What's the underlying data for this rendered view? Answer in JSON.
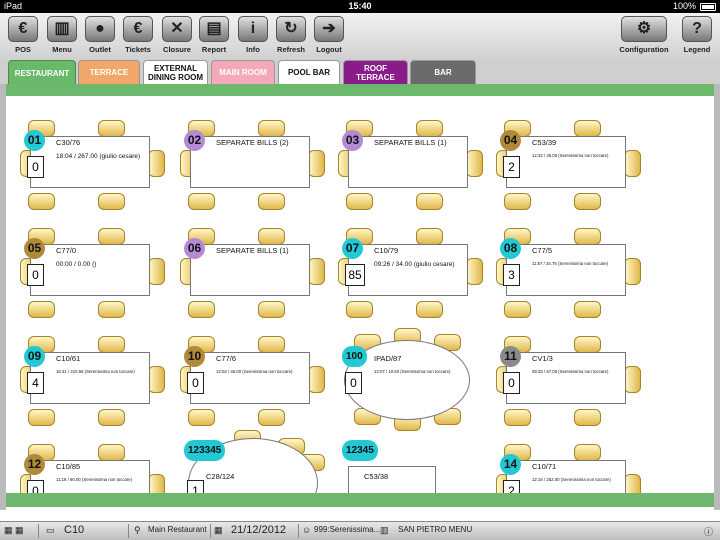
{
  "status_bar": {
    "device": "iPad",
    "time": "15:40",
    "battery": "100%"
  },
  "toolbar": {
    "left": [
      {
        "label": "POS",
        "icon": "cash-register-icon",
        "glyph": "€"
      },
      {
        "label": "Menu",
        "icon": "book-icon",
        "glyph": "▥"
      },
      {
        "label": "Outlet",
        "icon": "map-pin-icon",
        "glyph": "●"
      },
      {
        "label": "Tickets",
        "icon": "ticket-icon",
        "glyph": "€"
      },
      {
        "label": "Closure",
        "icon": "closure-icon",
        "glyph": "✕"
      },
      {
        "label": "Report",
        "icon": "report-icon",
        "glyph": "▤"
      },
      {
        "label": "Info",
        "icon": "info-icon",
        "glyph": "i"
      },
      {
        "label": "Refresh",
        "icon": "refresh-icon",
        "glyph": "↻"
      },
      {
        "label": "Logout",
        "icon": "logout-icon",
        "glyph": "➔"
      }
    ],
    "right": [
      {
        "label": "Configuration",
        "icon": "gears-icon",
        "glyph": "⚙"
      },
      {
        "label": "Legend",
        "icon": "legend-icon",
        "glyph": "?"
      }
    ]
  },
  "tabs": [
    {
      "label": "RESTAURANT",
      "bg": "#6ab86a",
      "fg": "#ffffff",
      "active": true
    },
    {
      "label": "TERRACE",
      "bg": "#f2a76a",
      "fg": "#ffffff",
      "active": false
    },
    {
      "label": "EXTERNAL",
      "label2": "DINING ROOM",
      "bg": "#ffffff",
      "fg": "#111111",
      "active": false
    },
    {
      "label": "MAIN ROOM",
      "bg": "#f4a8b8",
      "fg": "#ffffff",
      "active": false
    },
    {
      "label": "POOL BAR",
      "bg": "#ffffff",
      "fg": "#111111",
      "active": false
    },
    {
      "label": "ROOF TERRACE",
      "bg": "#8a1b8a",
      "fg": "#ffffff",
      "active": false
    },
    {
      "label": "BAR",
      "bg": "#6a6a6a",
      "fg": "#ffffff",
      "active": false
    }
  ],
  "badge_colors": {
    "cyan": "#22c8d4",
    "purple": "#b48ad4",
    "gold": "#b08a3a",
    "gray": "#8a8a8a"
  },
  "tables": [
    {
      "number": "01",
      "badge": "cyan",
      "name": "C30/76",
      "info": "18:04 / 267.00 (giulio cesare)",
      "covers": "0"
    },
    {
      "number": "02",
      "badge": "purple",
      "name": "SEPARATE BILLS (2)",
      "info": "",
      "covers": ""
    },
    {
      "number": "03",
      "badge": "purple",
      "name": "SEPARATE BILLS (1)",
      "info": "",
      "covers": ""
    },
    {
      "number": "04",
      "badge": "gold",
      "name": "C53/39",
      "info": "12:32 / 45.00 (Serenissima non toccare)",
      "covers": "2"
    },
    {
      "number": "05",
      "badge": "gold",
      "name": "C77/0",
      "info": "00:00 / 0.00 ()",
      "covers": "0"
    },
    {
      "number": "06",
      "badge": "purple",
      "name": "SEPARATE BILLS (1)",
      "info": "",
      "covers": ""
    },
    {
      "number": "07",
      "badge": "cyan",
      "name": "C10/79",
      "info": "09:26 / 34.00 (giulio cesare)",
      "covers": "85"
    },
    {
      "number": "08",
      "badge": "cyan",
      "name": "C77/5",
      "info": "11:57 / 34.75 (Serenissima non toccare)",
      "covers": "3"
    },
    {
      "number": "09",
      "badge": "cyan",
      "name": "C10/61",
      "info": "16:31 / 210.66 (Serenissima non toccare)",
      "covers": "4"
    },
    {
      "number": "10",
      "badge": "gold",
      "name": "C77/6",
      "info": "12:02 / 45.00 (Serenissima non toccare)",
      "covers": "0"
    },
    {
      "number": "100",
      "badge": "cyan",
      "name": "IPAD/87",
      "info": "13:07 / 10.50 (Serenissima non toccare)",
      "covers": "0"
    },
    {
      "number": "11",
      "badge": "gray",
      "name": "CV1/3",
      "info": "09:33 / 67.00 (Serenissima non toccare)",
      "covers": "0"
    },
    {
      "number": "12",
      "badge": "gold",
      "name": "C10/85",
      "info": "11:18 / 90.00 (Serenissima non toccare)",
      "covers": "0"
    },
    {
      "number": "123345",
      "badge": "cyan",
      "name": "C28/124",
      "info": "",
      "covers": "1"
    },
    {
      "number": "12345",
      "badge": "cyan",
      "name": "C53/38",
      "info": "",
      "covers": ""
    },
    {
      "number": "14",
      "badge": "cyan",
      "name": "C10/71",
      "info": "12:16 / 252.00 (Serenissima non toccare)",
      "covers": "2"
    }
  ],
  "bottom_bar": {
    "cover_code": "C10",
    "outlet": "Main Restaurant",
    "date": "21/12/2012",
    "user": "999:Serenissima...",
    "menu": "SAN PIETRO MENU"
  }
}
